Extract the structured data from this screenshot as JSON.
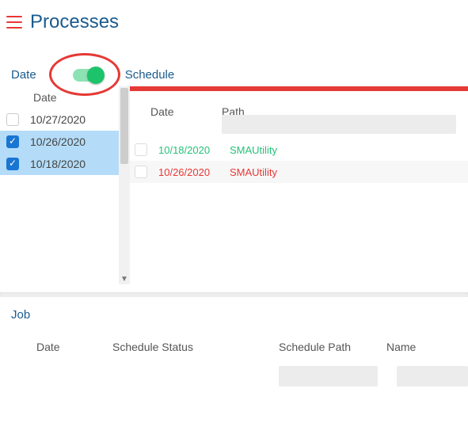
{
  "header": {
    "title": "Processes"
  },
  "mode": {
    "date_label": "Date",
    "schedule_label": "Schedule",
    "toggle_on": true
  },
  "left": {
    "column_label": "Date",
    "rows": [
      {
        "date": "10/27/2020",
        "checked": false
      },
      {
        "date": "10/26/2020",
        "checked": true
      },
      {
        "date": "10/18/2020",
        "checked": true
      }
    ]
  },
  "right_grid": {
    "headers": {
      "date": "Date",
      "path": "Path"
    },
    "rows": [
      {
        "date": "10/18/2020",
        "path": "SMAUtility",
        "status": "ok"
      },
      {
        "date": "10/26/2020",
        "path": "SMAUtility",
        "status": "err"
      }
    ]
  },
  "job": {
    "title": "Job",
    "headers": {
      "date": "Date",
      "status": "Schedule Status",
      "path": "Schedule Path",
      "name": "Name"
    }
  }
}
